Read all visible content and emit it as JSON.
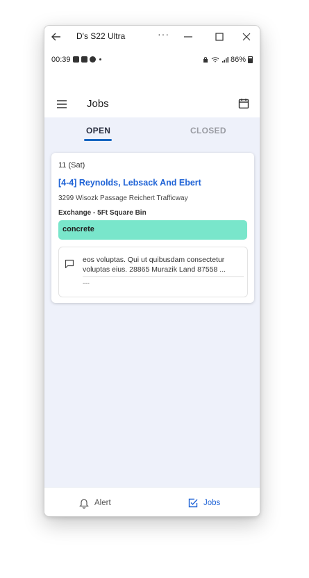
{
  "window": {
    "title": "D's S22 Ultra",
    "more": "···"
  },
  "status_bar": {
    "time": "00:39",
    "battery": "86%"
  },
  "app_bar": {
    "title": "Jobs"
  },
  "tabs": [
    {
      "label": "OPEN",
      "active": true
    },
    {
      "label": "CLOSED",
      "active": false
    }
  ],
  "jobs": [
    {
      "date": "11 (Sat)",
      "title": "[4-4] Reynolds, Lebsack And Ebert",
      "address": "3299 Wisozk Passage Reichert Trafficway",
      "service": "Exchange - 5Ft Square Bin",
      "material": "concrete",
      "note_line1": "eos voluptas. Qui ut quibusdam consectetur",
      "note_line2": "voluptas eius. 28865 Murazik Land 87558 ...",
      "note_footer": "---"
    }
  ],
  "bottom_nav": [
    {
      "label": "Alert",
      "icon": "bell-icon",
      "active": false
    },
    {
      "label": "Jobs",
      "icon": "checkbox-icon",
      "active": true
    }
  ],
  "colors": {
    "accent": "#1f63d6",
    "tag": "#79e6cb",
    "background": "#eef1fa"
  }
}
